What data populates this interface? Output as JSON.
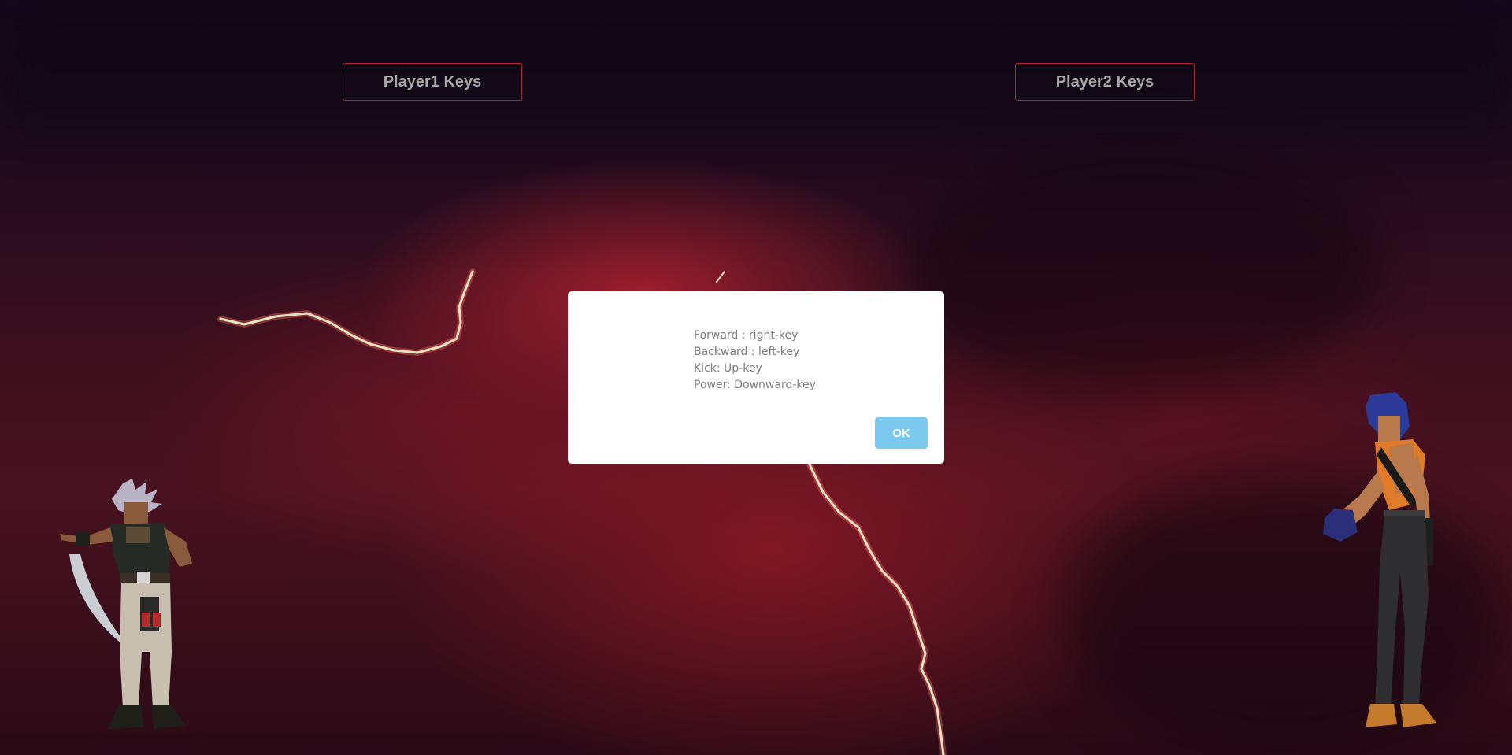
{
  "header": {
    "player1_keys_label": "Player1 Keys",
    "player2_keys_label": "Player2 Keys"
  },
  "dialog": {
    "lines": [
      "Forward : right-key",
      "Backward : left-key",
      "Kick: Up-key",
      "Power: Downward-key"
    ],
    "ok_label": "OK"
  },
  "colors": {
    "button_border": "#b42331",
    "ok_button": "#7cc9ef",
    "dialog_text": "#7a7a7a"
  },
  "fighters": {
    "player1": "fighter-silver-hair-icon",
    "player2": "fighter-blue-hair-icon"
  }
}
